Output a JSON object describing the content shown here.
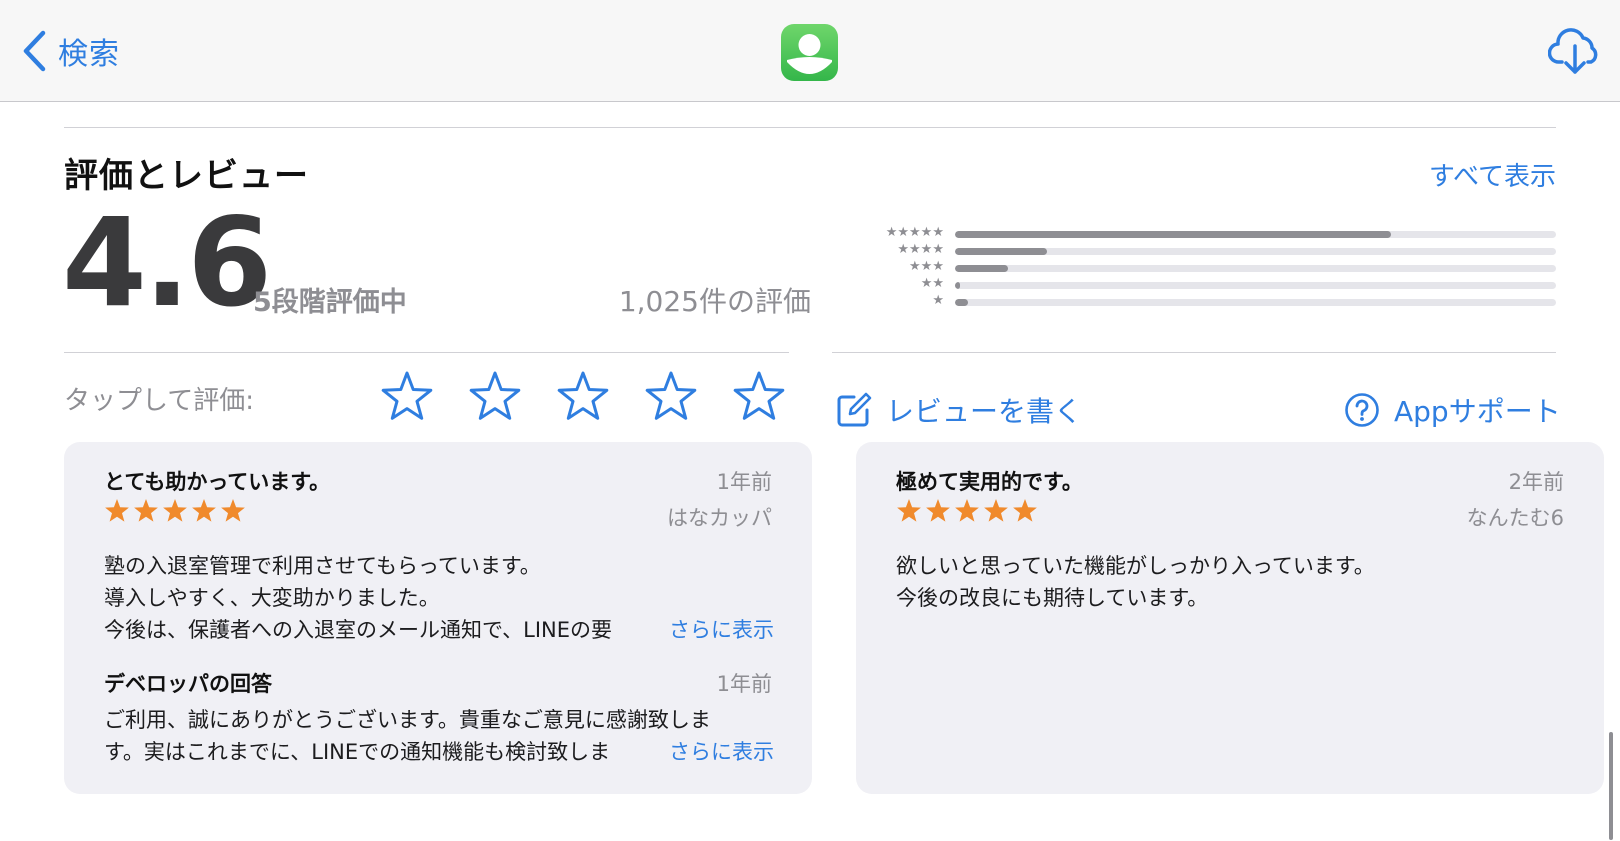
{
  "nav": {
    "back_label": "検索"
  },
  "ratings": {
    "section_title": "評価とレビュー",
    "see_all": "すべて表示",
    "average": "4.6",
    "out_of": "5段階評価中",
    "count_label": "1,025件の評価",
    "histogram": [
      {
        "stars": "★★★★★",
        "fraction": 0.725
      },
      {
        "stars": "★★★★",
        "fraction": 0.153
      },
      {
        "stars": "★★★",
        "fraction": 0.088
      },
      {
        "stars": "★★",
        "fraction": 0.008
      },
      {
        "stars": "★",
        "fraction": 0.022
      }
    ],
    "tap_label": "タップして評価:",
    "write_review": "レビューを書く",
    "app_support": "Appサポート"
  },
  "colors": {
    "accent": "#2f7ee0",
    "star_orange": "#f08a2c",
    "bar_fill": "#8e8e93"
  },
  "reviews": [
    {
      "title": "とても助かっています。",
      "date": "1年前",
      "author": "はなカッパ",
      "stars": 5,
      "lines": [
        "塾の入退室管理で利用させてもらっています。",
        "導入しやすく、大変助かりました。",
        "今後は、保護者への入退室のメール通知で、LINEの要"
      ],
      "more": "さらに表示",
      "developer_response": {
        "label": "デベロッパの回答",
        "date": "1年前",
        "lines": [
          "ご利用、誠にありがとうございます。貴重なご意見に感謝致しま",
          "す。実はこれまでに、LINEでの通知機能も検討致しま"
        ],
        "more": "さらに表示"
      }
    },
    {
      "title": "極めて実用的です。",
      "date": "2年前",
      "author": "なんたむ6",
      "stars": 5,
      "lines": [
        "欲しいと思っていた機能がしっかり入っています。",
        "今後の改良にも期待しています。"
      ]
    }
  ]
}
